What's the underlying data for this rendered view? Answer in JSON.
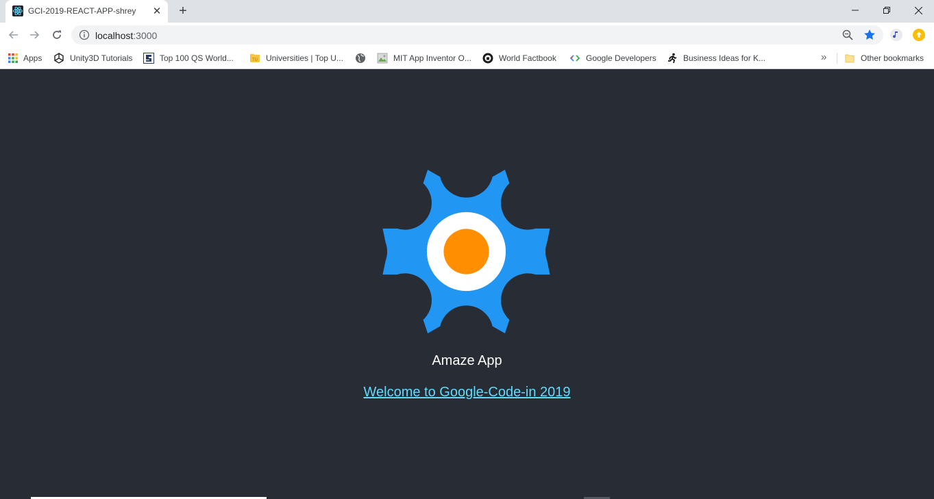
{
  "browser": {
    "tab": {
      "title": "GCI-2019-REACT-APP-shrey",
      "close_glyph": "✕"
    },
    "new_tab_glyph": "+",
    "window_controls": {
      "minimize": "—",
      "restore": "❐",
      "close": "✕"
    },
    "address": {
      "host": "localhost",
      "port": ":3000"
    },
    "bookmarks": [
      {
        "label": "Apps",
        "icon": "apps-grid-icon"
      },
      {
        "label": "Unity3D Tutorials",
        "icon": "unity-icon"
      },
      {
        "label": "Top 100 QS World...",
        "icon": "qs-icon"
      },
      {
        "label": "Universities | Top U...",
        "icon": "folder-tu-icon"
      },
      {
        "label": "",
        "icon": "globe-icon"
      },
      {
        "label": "MIT App Inventor O...",
        "icon": "mit-app-inventor-icon"
      },
      {
        "label": "World Factbook",
        "icon": "cia-seal-icon"
      },
      {
        "label": "Google Developers",
        "icon": "google-developers-icon"
      },
      {
        "label": "Business Ideas for K...",
        "icon": "runner-icon"
      }
    ],
    "overflow_glyph": "»",
    "other_bookmarks": "Other bookmarks"
  },
  "app": {
    "title": "Amaze App",
    "link_text": "Welcome to Google-Code-in 2019"
  },
  "colors": {
    "page_bg": "#282c34",
    "gear_blue": "#2196f3",
    "center_orange": "#ff8f00",
    "link": "#61dafb"
  }
}
